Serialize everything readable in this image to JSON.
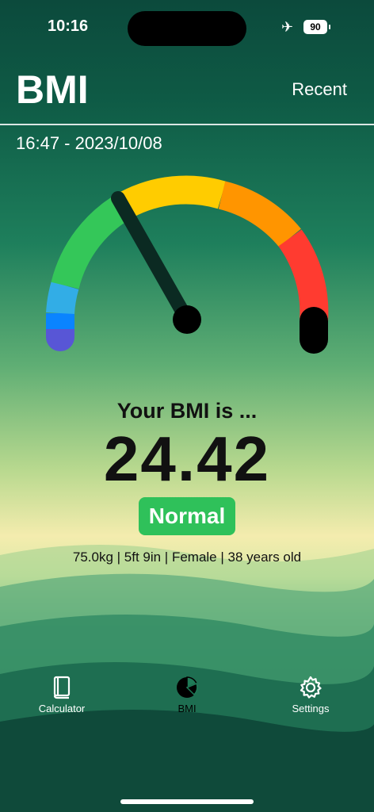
{
  "status_bar": {
    "time": "10:16",
    "battery": "90"
  },
  "header": {
    "title": "BMI",
    "recent_label": "Recent"
  },
  "record": {
    "datetime": "16:47 - 2023/10/08"
  },
  "gauge": {
    "bmi_value": 24.42
  },
  "result": {
    "heading": "Your BMI is ...",
    "value": "24.42",
    "category": "Normal",
    "details": "75.0kg | 5ft 9in | Female | 38 years old"
  },
  "tabs": [
    {
      "label": "Calculator",
      "icon": "book-icon"
    },
    {
      "label": "BMI",
      "icon": "pie-chart-icon"
    },
    {
      "label": "Settings",
      "icon": "gear-icon"
    }
  ],
  "colors": {
    "gauge_segments": [
      "#5856d6",
      "#0a84ff",
      "#32ade6",
      "#34c759",
      "#ffcc00",
      "#ff9500",
      "#ff3b30",
      "#000000"
    ],
    "badge": "#2fc15a"
  }
}
